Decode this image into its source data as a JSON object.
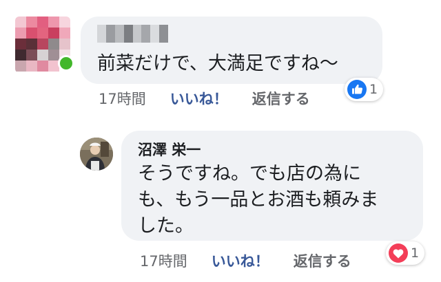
{
  "comments": [
    {
      "text": "前菜だけで、大満足ですね〜",
      "time": "17時間",
      "like_label": "いいね！",
      "reply_label": "返信する",
      "reaction": {
        "icon": "thumbs-up-icon",
        "count": "1",
        "color": "#1877f2"
      }
    },
    {
      "author": "沼澤 栄一",
      "text": "そうですね。でも店の為に\nも、もう一品とお酒も頼みま\nした。",
      "time": "17時間",
      "like_label": "いいね！",
      "reply_label": "返信する",
      "reaction": {
        "icon": "heart-icon",
        "count": "1",
        "color": "#f33e58"
      }
    }
  ],
  "colors": {
    "bubble": "#f0f2f5",
    "text": "#1c1e21",
    "meta": "#65676b",
    "like": "#385898",
    "online": "#42b72a"
  }
}
